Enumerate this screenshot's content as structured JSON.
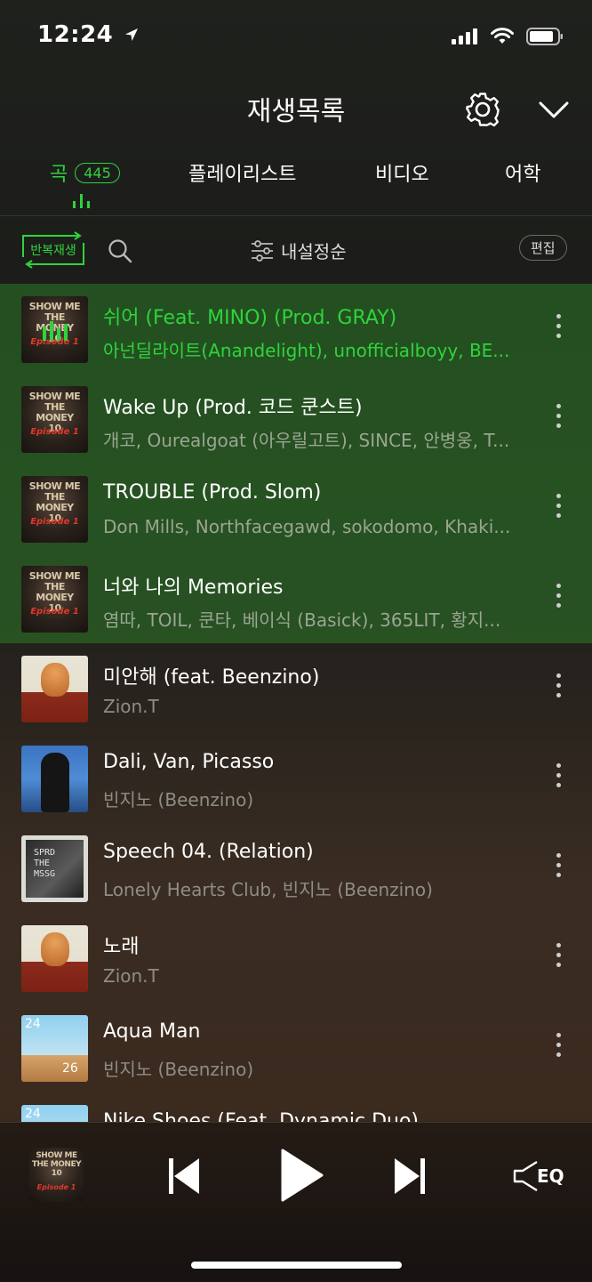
{
  "status_bar": {
    "time": "12:24"
  },
  "header": {
    "title": "재생목록"
  },
  "tabs": {
    "songs": {
      "label": "곡",
      "count": "445"
    },
    "playlist": {
      "label": "플레이리스트"
    },
    "video": {
      "label": "비디오"
    },
    "language": {
      "label": "어학"
    }
  },
  "toolbar": {
    "repeat_label": "반복재생",
    "sort_label": "내설정순",
    "edit_label": "편집"
  },
  "songs": [
    {
      "title": "쉬어 (Feat. MINO) (Prod. GRAY)",
      "artist": "아넌딜라이트(Anandelight), unofficialboyy, BE...",
      "art": "smtm",
      "playing": true,
      "highlight": true
    },
    {
      "title": "Wake Up (Prod. 코드 쿤스트)",
      "artist": "개코, Ourealgoat (아우릴고트), SINCE, 안병웅, T...",
      "art": "smtm",
      "playing": false,
      "highlight": true
    },
    {
      "title": "TROUBLE (Prod. Slom)",
      "artist": "Don Mills, Northfacegawd, sokodomo, Khaki...",
      "art": "smtm",
      "playing": false,
      "highlight": true
    },
    {
      "title": "너와 나의 Memories",
      "artist": "염따, TOIL, 쿤타, 베이식 (Basick), 365LIT, 황지...",
      "art": "smtm",
      "playing": false,
      "highlight": true
    },
    {
      "title": "미안해 (feat. Beenzino)",
      "artist": "Zion.T",
      "art": "zion",
      "playing": false,
      "highlight": false
    },
    {
      "title": "Dali, Van, Picasso",
      "artist": "빈지노 (Beenzino)",
      "art": "beenzino",
      "playing": false,
      "highlight": false
    },
    {
      "title": "Speech 04. (Relation)",
      "artist": "Lonely Hearts Club, 빈지노 (Beenzino)",
      "art": "speech",
      "playing": false,
      "highlight": false
    },
    {
      "title": "노래",
      "artist": "Zion.T",
      "art": "zion",
      "playing": false,
      "highlight": false
    },
    {
      "title": "Aqua Man",
      "artist": "빈지노 (Beenzino)",
      "art": "aqua",
      "playing": false,
      "highlight": false
    },
    {
      "title": "Nike Shoes (Feat. Dynamic Duo)",
      "artist": "",
      "art": "aqua",
      "playing": false,
      "highlight": false
    }
  ],
  "art_text": {
    "smtm_line1": "SHOW ME",
    "smtm_line2": "THE MONEY",
    "smtm_line3": "10",
    "smtm_episode": "Episode 1",
    "speech_lines": "SPRD\nTHE\nMSSG",
    "aqua_num1": "24",
    "aqua_num2": "26"
  },
  "player": {
    "eq_label": "EQ",
    "now_playing_art": "smtm"
  },
  "colors": {
    "accent": "#2fd33c",
    "highlight_bg": "#2d5e26"
  }
}
